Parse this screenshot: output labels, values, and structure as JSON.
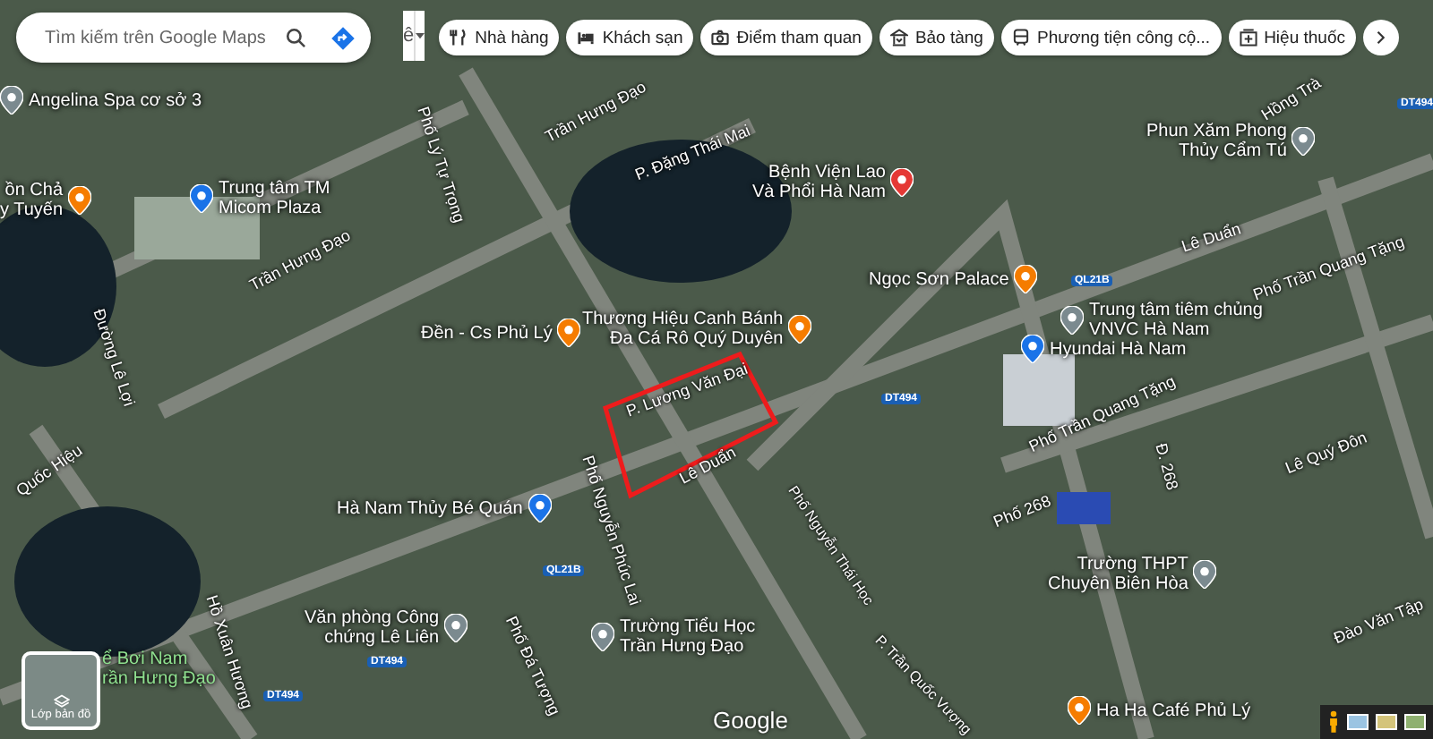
{
  "search": {
    "placeholder": "Tìm kiếm trên Google Maps"
  },
  "input_tool": {
    "label": "ê"
  },
  "chips": [
    {
      "label": "Nhà hàng",
      "kind": "restaurant"
    },
    {
      "label": "Khách sạn",
      "kind": "hotel"
    },
    {
      "label": "Điểm tham quan",
      "kind": "camera"
    },
    {
      "label": "Bảo tàng",
      "kind": "museum"
    },
    {
      "label": "Phương tiện công cộ...",
      "kind": "transit"
    },
    {
      "label": "Hiệu thuốc",
      "kind": "pharmacy"
    }
  ],
  "places": [
    {
      "lines": [
        "Angelina Spa cơ sở 3"
      ],
      "kind": "pin"
    },
    {
      "lines": [
        "ồn Chả",
        "y Tuyến"
      ],
      "kind": "food"
    },
    {
      "lines": [
        "Trung tâm TM",
        "Micom Plaza"
      ],
      "kind": "shop"
    },
    {
      "lines": [
        "Bệnh Viện Lao",
        "Và Phổi Hà Nam"
      ],
      "kind": "hospital"
    },
    {
      "lines": [
        "Phun Xăm Phong",
        "Thủy Cẩm Tú"
      ],
      "kind": "pin"
    },
    {
      "lines": [
        "Ngọc Sơn Palace"
      ],
      "kind": "food"
    },
    {
      "lines": [
        "Đền - Cs Phủ Lý"
      ],
      "kind": "cafe"
    },
    {
      "lines": [
        "Thương Hiệu Canh Bánh",
        "Đa Cá Rô Quý Duyên"
      ],
      "kind": "food"
    },
    {
      "lines": [
        "Trung tâm tiêm chủng",
        "VNVC Hà Nam"
      ],
      "kind": "pin"
    },
    {
      "lines": [
        "Hyundai Hà Nam"
      ],
      "kind": "shop"
    },
    {
      "lines": [
        "Hà Nam Thủy Bé Quán"
      ],
      "kind": "shop"
    },
    {
      "lines": [
        "Văn phòng Công",
        "chứng Lê Liên"
      ],
      "kind": "pin"
    },
    {
      "lines": [
        "Trường Tiểu Học",
        "Trần Hưng Đạo"
      ],
      "kind": "school"
    },
    {
      "lines": [
        "Trường THPT",
        "Chuyên Biên Hòa"
      ],
      "kind": "school"
    },
    {
      "lines": [
        "Ha Ha Café Phủ Lý"
      ],
      "kind": "cafe"
    },
    {
      "lines": [
        "ể Bơi Nam",
        "rần Hưng Đạo"
      ],
      "kind": "park"
    }
  ],
  "streets": [
    "Phố Lý Tự Trọng",
    "Trần Hưng Đạo",
    "P. Đặng Thái Mai",
    "Hồng Trà",
    "Lê Duẩn",
    "Lê Duẩn",
    "Trần Hưng Đạo",
    "Đường Lê Lợi",
    "P. Lương Văn Đại",
    "Phố Nguyễn Phúc Lai",
    "Phố Trần Quang Tặng",
    "Phố Trần Quang Tặng",
    "Lê Quý Đôn",
    "Đ. 268",
    "Quốc Hiệu",
    "Phố Nguyễn Thái Học",
    "Phố 268",
    "Hồ Xuân Hương",
    "Phố Đá Tượng",
    "P. Trần Quốc Vượng",
    "Đào Văn Tập"
  ],
  "road_shields": [
    "QL21B",
    "DT494",
    "DT494",
    "QL21B",
    "DT494",
    "DT494"
  ],
  "layers_button": {
    "label": "Lớp bản đồ"
  },
  "logo": "Google"
}
